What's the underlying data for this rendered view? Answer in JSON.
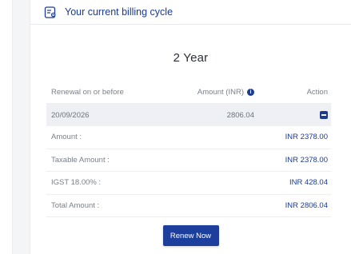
{
  "header": {
    "title": "Your current billing cycle",
    "icon": "billing-document-icon"
  },
  "plan": {
    "title": "2 Year"
  },
  "table": {
    "columns": {
      "renewal": "Renewal on or before",
      "amount": "Amount (INR)",
      "action": "Action"
    },
    "main_row": {
      "date": "20/09/2026",
      "amount": "2806.04"
    },
    "details": [
      {
        "label": "Amount :",
        "value": "INR 2378.00"
      },
      {
        "label": "Taxable Amount :",
        "value": "INR 2378.00"
      },
      {
        "label": "IGST 18.00% :",
        "value": "INR 428.04"
      },
      {
        "label": "Total Amount :",
        "value": "INR 2806.04"
      }
    ]
  },
  "actions": {
    "renew_label": "Renew Now"
  },
  "colors": {
    "accent": "#1c3f9e",
    "text_blue": "#1d3c8f"
  }
}
